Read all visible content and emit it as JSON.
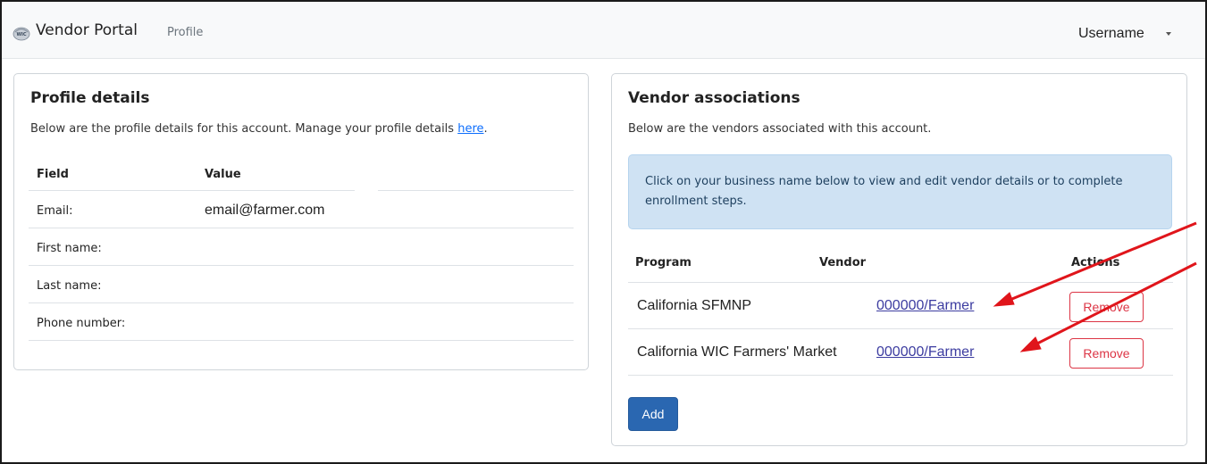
{
  "navbar": {
    "brand_logo_text": "WIC",
    "brand_name": "Vendor Portal",
    "breadcrumb": "Profile",
    "username": "Username"
  },
  "profile": {
    "title": "Profile details",
    "subtitle": "Below are the profile details for this account. Manage your profile details",
    "link_label": "here",
    "subtitle_end": ".",
    "columns": [
      "Field",
      "Value"
    ],
    "rows": [
      {
        "field": "Email:",
        "value": "email@farmer.com"
      },
      {
        "field": "First name:",
        "value": ""
      },
      {
        "field": "Last name:",
        "value": ""
      },
      {
        "field": "Phone number:",
        "value": ""
      }
    ]
  },
  "vendors": {
    "title": "Vendor associations",
    "subtitle": "Below are the vendors associated with this account.",
    "info_text": "Click on your business name below to view and edit vendor details or to complete enrollment steps.",
    "columns": [
      "Program",
      "Vendor",
      "Actions"
    ],
    "rows": [
      {
        "program": "California SFMNP",
        "vendor": "000000/Farmer",
        "action": "Remove"
      },
      {
        "program": "California WIC Farmers' Market",
        "vendor": "000000/Farmer",
        "action": "Remove"
      }
    ],
    "add_label": "Add"
  },
  "colors": {
    "accent": "#2a67b1",
    "danger": "#dc3545",
    "info_bg": "#cfe2f3",
    "annotation_arrow": "#e0151b"
  }
}
